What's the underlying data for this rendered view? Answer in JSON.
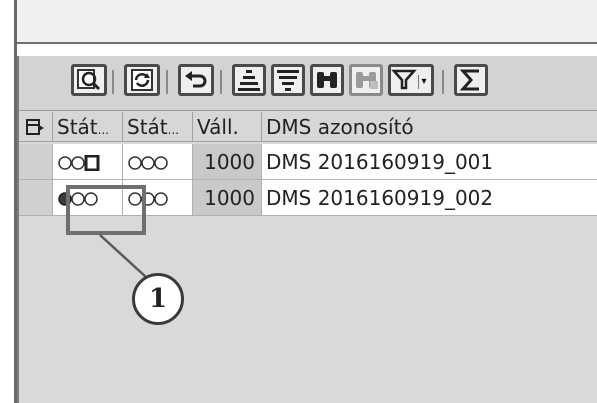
{
  "toolbar": {
    "buttons": [
      "details-icon",
      "refresh-icon",
      "undo-icon",
      "sort-ascending-icon",
      "sort-descending-icon",
      "find-icon",
      "find-next-icon",
      "filter-icon",
      "sum-icon"
    ]
  },
  "grid": {
    "columns": [
      "Stát",
      "Stát",
      "Váll.",
      "DMS azonosító"
    ],
    "rows": [
      {
        "company": "1000",
        "dms_id": "DMS 2016160919_001"
      },
      {
        "company": "1000",
        "dms_id": "DMS 2016160919_002"
      }
    ]
  },
  "callout": {
    "number": "1"
  },
  "colors": {
    "toolbar_bg": "#d3d3d3",
    "callout_border": "#6f6f6f"
  }
}
